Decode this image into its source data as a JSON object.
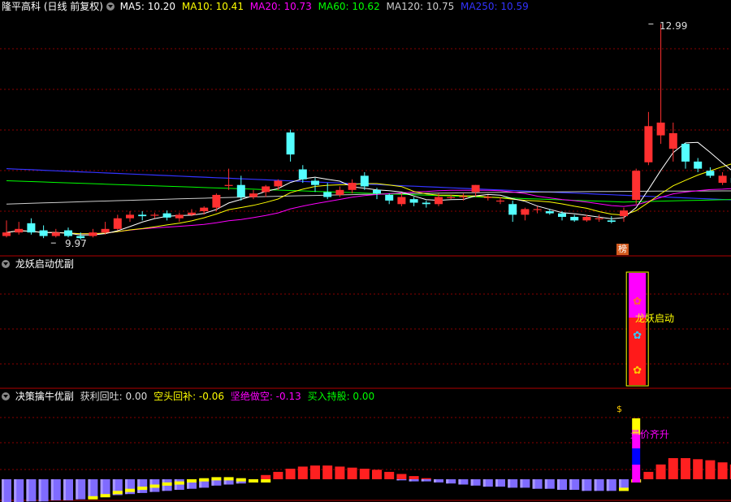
{
  "panel1": {
    "title": "隆平高科 (日线 前复权)",
    "ma": [
      {
        "label": "MA5: 10.20",
        "color": "#ffffff"
      },
      {
        "label": "MA10: 10.41",
        "color": "#ffff00"
      },
      {
        "label": "MA20: 10.73",
        "color": "#ff00ff"
      },
      {
        "label": "MA60: 10.62",
        "color": "#00ff00"
      },
      {
        "label": "MA120: 10.75",
        "color": "#cccccc"
      },
      {
        "label": "MA250: 10.59",
        "color": "#3333ff"
      }
    ],
    "high_label": "12.99",
    "low_label": "9.97",
    "badge": "榜"
  },
  "panel2": {
    "title": "龙妖启动优副",
    "signal_text": "龙妖启动"
  },
  "panel3": {
    "title": "决策擒牛优副",
    "values": [
      {
        "label": "获利回吐: 0.00",
        "color": "#dddddd"
      },
      {
        "label": "空头回补: -0.06",
        "color": "#ffff00"
      },
      {
        "label": "坚绝做空: -0.13",
        "color": "#ff00ff"
      },
      {
        "label": "买入持股: 0.00",
        "color": "#00ff00"
      }
    ],
    "signal_text": "量价齐升"
  },
  "colors": {
    "up": "#ff3030",
    "down": "#54ffff",
    "grid": "#8b0000"
  },
  "chart_data": {
    "type": "candlestick",
    "price_range": [
      9.8,
      13.1
    ],
    "candles": [
      [
        10.0,
        10.05,
        10.22,
        9.98
      ],
      [
        10.05,
        10.1,
        10.2,
        10.02
      ],
      [
        10.18,
        10.05,
        10.25,
        10.02
      ],
      [
        10.08,
        10.0,
        10.15,
        9.97
      ],
      [
        10.0,
        10.05,
        10.1,
        9.98
      ],
      [
        10.08,
        10.0,
        10.12,
        9.98
      ],
      [
        10.0,
        9.97,
        10.05,
        9.95
      ],
      [
        10.0,
        10.05,
        10.1,
        9.98
      ],
      [
        10.05,
        10.1,
        10.2,
        10.02
      ],
      [
        10.1,
        10.25,
        10.3,
        10.08
      ],
      [
        10.25,
        10.3,
        10.35,
        10.2
      ],
      [
        10.3,
        10.28,
        10.35,
        10.22
      ],
      [
        10.3,
        10.3,
        10.33,
        10.25
      ],
      [
        10.32,
        10.26,
        10.36,
        10.22
      ],
      [
        10.25,
        10.3,
        10.33,
        10.2
      ],
      [
        10.3,
        10.33,
        10.38,
        10.28
      ],
      [
        10.35,
        10.4,
        10.42,
        10.3
      ],
      [
        10.4,
        10.58,
        10.6,
        10.35
      ],
      [
        10.72,
        10.72,
        10.95,
        10.65
      ],
      [
        10.72,
        10.55,
        10.85,
        10.5
      ],
      [
        10.55,
        10.6,
        10.65,
        10.52
      ],
      [
        10.62,
        10.7,
        10.72,
        10.55
      ],
      [
        10.7,
        10.78,
        10.8,
        10.65
      ],
      [
        11.46,
        11.15,
        11.5,
        11.05
      ],
      [
        10.94,
        10.8,
        11.0,
        10.75
      ],
      [
        10.78,
        10.72,
        10.82,
        10.62
      ],
      [
        10.62,
        10.55,
        10.75,
        10.52
      ],
      [
        10.58,
        10.65,
        10.7,
        10.55
      ],
      [
        10.65,
        10.75,
        10.8,
        10.6
      ],
      [
        10.85,
        10.7,
        10.9,
        10.65
      ],
      [
        10.65,
        10.6,
        10.68,
        10.52
      ],
      [
        10.58,
        10.5,
        10.6,
        10.45
      ],
      [
        10.45,
        10.55,
        10.6,
        10.42
      ],
      [
        10.52,
        10.47,
        10.55,
        10.42
      ],
      [
        10.47,
        10.45,
        10.5,
        10.4
      ],
      [
        10.45,
        10.55,
        10.6,
        10.42
      ],
      [
        10.55,
        10.55,
        10.58,
        10.52
      ],
      [
        10.55,
        10.56,
        10.6,
        10.5
      ],
      [
        10.62,
        10.72,
        10.72,
        10.55
      ],
      [
        10.55,
        10.55,
        10.58,
        10.5
      ],
      [
        10.5,
        10.5,
        10.55,
        10.45
      ],
      [
        10.45,
        10.3,
        10.5,
        10.2
      ],
      [
        10.3,
        10.38,
        10.4,
        10.22
      ],
      [
        10.38,
        10.38,
        10.42,
        10.32
      ],
      [
        10.35,
        10.32,
        10.38,
        10.3
      ],
      [
        10.32,
        10.27,
        10.35,
        10.22
      ],
      [
        10.27,
        10.22,
        10.3,
        10.2
      ],
      [
        10.22,
        10.27,
        10.3,
        10.2
      ],
      [
        10.25,
        10.25,
        10.3,
        10.2
      ],
      [
        10.22,
        10.2,
        10.28,
        10.18
      ],
      [
        10.28,
        10.36,
        10.4,
        10.2
      ],
      [
        10.51,
        10.92,
        10.95,
        10.45
      ],
      [
        11.04,
        11.55,
        11.75,
        11.0
      ],
      [
        11.42,
        11.6,
        12.99,
        11.3
      ],
      [
        11.23,
        11.45,
        11.6,
        11.05
      ],
      [
        11.3,
        11.05,
        11.32,
        10.95
      ],
      [
        11.05,
        10.95,
        11.1,
        10.9
      ],
      [
        10.92,
        10.85,
        10.97,
        10.82
      ],
      [
        10.75,
        10.85,
        10.9,
        10.72
      ],
      [
        10.82,
        10.75,
        10.85,
        10.55
      ]
    ],
    "moving_averages": [
      "MA5",
      "MA10",
      "MA20",
      "MA60",
      "MA120",
      "MA250"
    ],
    "signal_bar_index": 51,
    "histogram": {
      "blue": [
        0.22,
        0.22,
        0.21,
        0.21,
        0.2,
        0.2,
        0.19,
        0.18,
        0.17,
        0.15,
        0.14,
        0.13,
        0.12,
        0.11,
        0.1,
        0.09,
        0.08,
        0.06,
        0.05,
        0.04,
        0.03,
        0,
        0,
        0,
        0,
        0,
        0,
        0,
        0,
        0,
        0,
        0,
        0.01,
        0.02,
        0.02,
        0.03,
        0.04,
        0.05,
        0.06,
        0.07,
        0.07,
        0.08,
        0.08,
        0.09,
        0.09,
        0.1,
        0.1,
        0.11,
        0.11,
        0.11,
        0.11,
        0,
        0,
        0,
        0,
        0,
        0,
        0,
        0,
        0
      ],
      "yellow": [
        0,
        0,
        0,
        0,
        0,
        0,
        0,
        0.02,
        0.03,
        0.04,
        0.05,
        0.06,
        0.07,
        0.08,
        0.08,
        0.09,
        0.09,
        0.08,
        0.07,
        0.05,
        0.03,
        0.02,
        0,
        0,
        0,
        0,
        0,
        0,
        0,
        0,
        0,
        0,
        0,
        0,
        0,
        0,
        0,
        0,
        0,
        0,
        0,
        0,
        0,
        0,
        0,
        0,
        0,
        0,
        0,
        0,
        0.03,
        0.06,
        0,
        0,
        0,
        0,
        0,
        0,
        0,
        0
      ],
      "red": [
        0,
        0,
        0,
        0,
        0,
        0,
        0,
        0,
        0,
        0,
        0,
        0,
        0,
        0,
        0,
        0,
        0,
        0,
        0,
        0,
        0,
        0.04,
        0.07,
        0.1,
        0.12,
        0.13,
        0.13,
        0.12,
        0.11,
        0.1,
        0.09,
        0.07,
        0.05,
        0.03,
        0.01,
        0,
        0,
        0,
        0,
        0,
        0,
        0,
        0,
        0,
        0,
        0,
        0,
        0,
        0,
        0,
        0,
        0,
        0.07,
        0.14,
        0.2,
        0.2,
        0.19,
        0.18,
        0.16,
        0.14
      ]
    }
  }
}
